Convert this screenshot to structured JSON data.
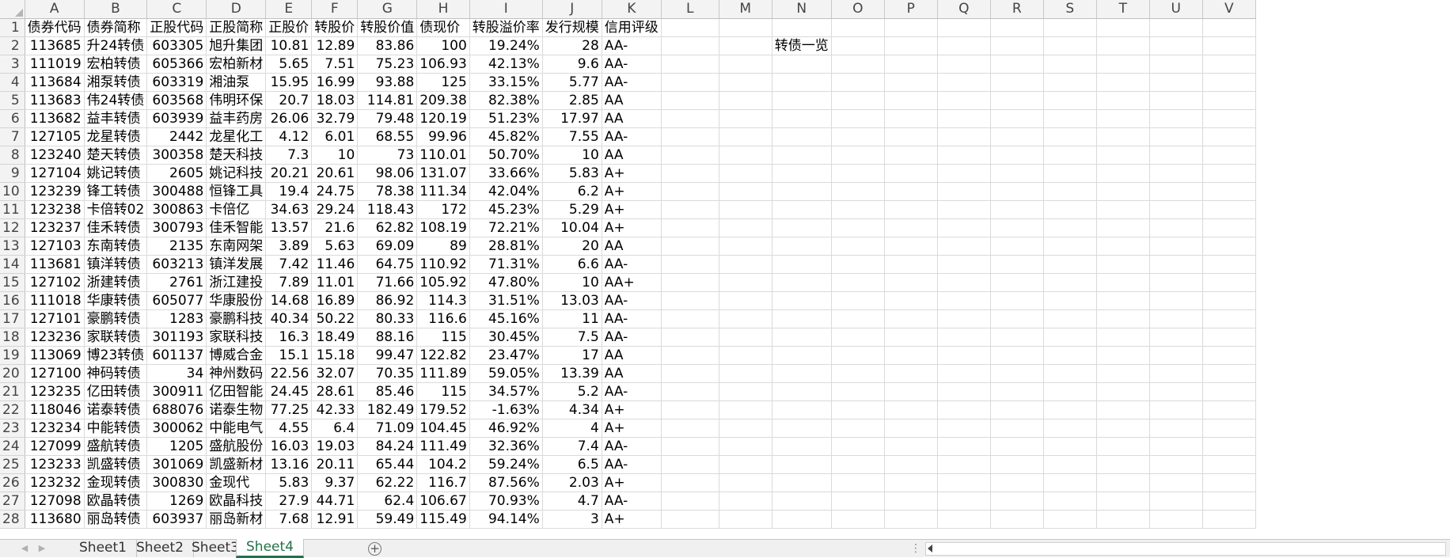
{
  "columns": [
    "A",
    "B",
    "C",
    "D",
    "E",
    "F",
    "G",
    "H",
    "I",
    "J",
    "K",
    "L",
    "M",
    "N",
    "O",
    "P",
    "Q",
    "R",
    "S",
    "T",
    "U",
    "V"
  ],
  "rows": [
    [
      "债券代码",
      "债券简称",
      "正股代码",
      "正股简称",
      "正股价",
      "转股价",
      "转股价值",
      "债现价",
      "转股溢价率",
      "发行规模",
      "信用评级",
      "",
      "",
      "",
      "",
      "",
      "",
      "",
      "",
      "",
      "",
      ""
    ],
    [
      "113685",
      "升24转债",
      "603305",
      "旭升集团",
      "10.81",
      "12.89",
      "83.86",
      "100",
      "19.24%",
      "28",
      "AA-",
      "",
      "",
      "转债一览",
      "",
      "",
      "",
      "",
      "",
      "",
      "",
      ""
    ],
    [
      "111019",
      "宏柏转债",
      "605366",
      "宏柏新材",
      "5.65",
      "7.51",
      "75.23",
      "106.93",
      "42.13%",
      "9.6",
      "AA-",
      "",
      "",
      "",
      "",
      "",
      "",
      "",
      "",
      "",
      "",
      ""
    ],
    [
      "113684",
      "湘泵转债",
      "603319",
      "湘油泵",
      "15.95",
      "16.99",
      "93.88",
      "125",
      "33.15%",
      "5.77",
      "AA-",
      "",
      "",
      "",
      "",
      "",
      "",
      "",
      "",
      "",
      "",
      ""
    ],
    [
      "113683",
      "伟24转债",
      "603568",
      "伟明环保",
      "20.7",
      "18.03",
      "114.81",
      "209.38",
      "82.38%",
      "2.85",
      "AA",
      "",
      "",
      "",
      "",
      "",
      "",
      "",
      "",
      "",
      "",
      ""
    ],
    [
      "113682",
      "益丰转债",
      "603939",
      "益丰药房",
      "26.06",
      "32.79",
      "79.48",
      "120.19",
      "51.23%",
      "17.97",
      "AA",
      "",
      "",
      "",
      "",
      "",
      "",
      "",
      "",
      "",
      "",
      ""
    ],
    [
      "127105",
      "龙星转债",
      "2442",
      "龙星化工",
      "4.12",
      "6.01",
      "68.55",
      "99.96",
      "45.82%",
      "7.55",
      "AA-",
      "",
      "",
      "",
      "",
      "",
      "",
      "",
      "",
      "",
      "",
      ""
    ],
    [
      "123240",
      "楚天转债",
      "300358",
      "楚天科技",
      "7.3",
      "10",
      "73",
      "110.01",
      "50.70%",
      "10",
      "AA",
      "",
      "",
      "",
      "",
      "",
      "",
      "",
      "",
      "",
      "",
      ""
    ],
    [
      "127104",
      "姚记转债",
      "2605",
      "姚记科技",
      "20.21",
      "20.61",
      "98.06",
      "131.07",
      "33.66%",
      "5.83",
      "A+",
      "",
      "",
      "",
      "",
      "",
      "",
      "",
      "",
      "",
      "",
      ""
    ],
    [
      "123239",
      "锋工转债",
      "300488",
      "恒锋工具",
      "19.4",
      "24.75",
      "78.38",
      "111.34",
      "42.04%",
      "6.2",
      "A+",
      "",
      "",
      "",
      "",
      "",
      "",
      "",
      "",
      "",
      "",
      ""
    ],
    [
      "123238",
      "卡倍转02",
      "300863",
      "卡倍亿",
      "34.63",
      "29.24",
      "118.43",
      "172",
      "45.23%",
      "5.29",
      "A+",
      "",
      "",
      "",
      "",
      "",
      "",
      "",
      "",
      "",
      "",
      ""
    ],
    [
      "123237",
      "佳禾转债",
      "300793",
      "佳禾智能",
      "13.57",
      "21.6",
      "62.82",
      "108.19",
      "72.21%",
      "10.04",
      "A+",
      "",
      "",
      "",
      "",
      "",
      "",
      "",
      "",
      "",
      "",
      ""
    ],
    [
      "127103",
      "东南转债",
      "2135",
      "东南网架",
      "3.89",
      "5.63",
      "69.09",
      "89",
      "28.81%",
      "20",
      "AA",
      "",
      "",
      "",
      "",
      "",
      "",
      "",
      "",
      "",
      "",
      ""
    ],
    [
      "113681",
      "镇洋转债",
      "603213",
      "镇洋发展",
      "7.42",
      "11.46",
      "64.75",
      "110.92",
      "71.31%",
      "6.6",
      "AA-",
      "",
      "",
      "",
      "",
      "",
      "",
      "",
      "",
      "",
      "",
      ""
    ],
    [
      "127102",
      "浙建转债",
      "2761",
      "浙江建投",
      "7.89",
      "11.01",
      "71.66",
      "105.92",
      "47.80%",
      "10",
      "AA+",
      "",
      "",
      "",
      "",
      "",
      "",
      "",
      "",
      "",
      "",
      ""
    ],
    [
      "111018",
      "华康转债",
      "605077",
      "华康股份",
      "14.68",
      "16.89",
      "86.92",
      "114.3",
      "31.51%",
      "13.03",
      "AA-",
      "",
      "",
      "",
      "",
      "",
      "",
      "",
      "",
      "",
      "",
      ""
    ],
    [
      "127101",
      "豪鹏转债",
      "1283",
      "豪鹏科技",
      "40.34",
      "50.22",
      "80.33",
      "116.6",
      "45.16%",
      "11",
      "AA-",
      "",
      "",
      "",
      "",
      "",
      "",
      "",
      "",
      "",
      "",
      ""
    ],
    [
      "123236",
      "家联转债",
      "301193",
      "家联科技",
      "16.3",
      "18.49",
      "88.16",
      "115",
      "30.45%",
      "7.5",
      "AA-",
      "",
      "",
      "",
      "",
      "",
      "",
      "",
      "",
      "",
      "",
      ""
    ],
    [
      "113069",
      "博23转债",
      "601137",
      "博威合金",
      "15.1",
      "15.18",
      "99.47",
      "122.82",
      "23.47%",
      "17",
      "AA",
      "",
      "",
      "",
      "",
      "",
      "",
      "",
      "",
      "",
      "",
      ""
    ],
    [
      "127100",
      "神码转债",
      "34",
      "神州数码",
      "22.56",
      "32.07",
      "70.35",
      "111.89",
      "59.05%",
      "13.39",
      "AA",
      "",
      "",
      "",
      "",
      "",
      "",
      "",
      "",
      "",
      "",
      ""
    ],
    [
      "123235",
      "亿田转债",
      "300911",
      "亿田智能",
      "24.45",
      "28.61",
      "85.46",
      "115",
      "34.57%",
      "5.2",
      "AA-",
      "",
      "",
      "",
      "",
      "",
      "",
      "",
      "",
      "",
      "",
      ""
    ],
    [
      "118046",
      "诺泰转债",
      "688076",
      "诺泰生物",
      "77.25",
      "42.33",
      "182.49",
      "179.52",
      "-1.63%",
      "4.34",
      "A+",
      "",
      "",
      "",
      "",
      "",
      "",
      "",
      "",
      "",
      "",
      ""
    ],
    [
      "123234",
      "中能转债",
      "300062",
      "中能电气",
      "4.55",
      "6.4",
      "71.09",
      "104.45",
      "46.92%",
      "4",
      "A+",
      "",
      "",
      "",
      "",
      "",
      "",
      "",
      "",
      "",
      "",
      ""
    ],
    [
      "127099",
      "盛航转债",
      "1205",
      "盛航股份",
      "16.03",
      "19.03",
      "84.24",
      "111.49",
      "32.36%",
      "7.4",
      "AA-",
      "",
      "",
      "",
      "",
      "",
      "",
      "",
      "",
      "",
      "",
      ""
    ],
    [
      "123233",
      "凯盛转债",
      "301069",
      "凯盛新材",
      "13.16",
      "20.11",
      "65.44",
      "104.2",
      "59.24%",
      "6.5",
      "AA-",
      "",
      "",
      "",
      "",
      "",
      "",
      "",
      "",
      "",
      "",
      ""
    ],
    [
      "123232",
      "金现转债",
      "300830",
      "金现代",
      "5.83",
      "9.37",
      "62.22",
      "116.7",
      "87.56%",
      "2.03",
      "A+",
      "",
      "",
      "",
      "",
      "",
      "",
      "",
      "",
      "",
      "",
      ""
    ],
    [
      "127098",
      "欧晶转债",
      "1269",
      "欧晶科技",
      "27.9",
      "44.71",
      "62.4",
      "106.67",
      "70.93%",
      "4.7",
      "AA-",
      "",
      "",
      "",
      "",
      "",
      "",
      "",
      "",
      "",
      "",
      ""
    ],
    [
      "113680",
      "丽岛转债",
      "603937",
      "丽岛新材",
      "7.68",
      "12.91",
      "59.49",
      "115.49",
      "94.14%",
      "3",
      "A+",
      "",
      "",
      "",
      "",
      "",
      "",
      "",
      "",
      "",
      "",
      ""
    ]
  ],
  "sheet_tabs": [
    "Sheet1",
    "Sheet2",
    "Sheet3",
    "Sheet4"
  ],
  "active_sheet": "Sheet4",
  "add_sheet_symbol": "+",
  "accent_color": "#217346"
}
